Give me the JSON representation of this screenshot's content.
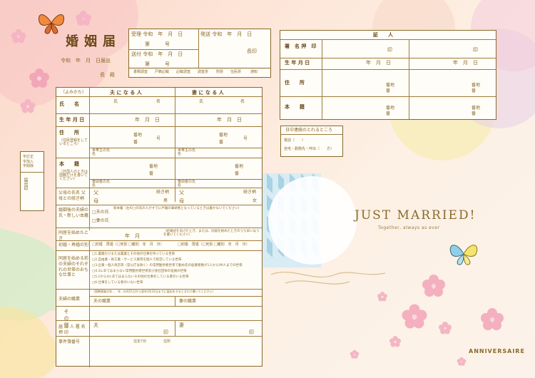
{
  "header": {
    "title": "婚姻届",
    "filed_date": "令和　年　月　日届出",
    "to_mayor": "長　殿"
  },
  "receipt": {
    "received": "受理 令和　年　月　日",
    "number1": "第　　　号",
    "sent": "送付 令和　年　月　日",
    "number2": "第　　　号",
    "issue": "発送 令和　年　月　日",
    "head": "長印",
    "checks": [
      "書類調査",
      "戸籍記載",
      "記載調査",
      "調査票",
      "附票",
      "住民票",
      "通知"
    ]
  },
  "side_stamp": {
    "label1": "字訂正\n字加入\n字削除",
    "label2": "届出印"
  },
  "columns": {
    "furigana": "（よみかた）",
    "husband": "夫 に な る 人",
    "wife": "妻 に な る 人"
  },
  "rows": {
    "name": "氏　　名",
    "name_sub_last": "氏",
    "name_sub_first": "名",
    "birth": "生 年 月 日",
    "birth_val": "年　月　日",
    "address": "住　　所",
    "address_note": "（住民登録をしているところ）",
    "banchi": "番地",
    "ban": "番",
    "go": "号",
    "setainushi": "世帯主の氏名",
    "honseki": "本　　籍",
    "honseki_note": "（外国人のときは国籍だけを書いてください）",
    "hittousha": "筆頭者の氏名",
    "parents": "父母の氏名 父母との続き柄",
    "father": "父",
    "mother": "母",
    "relation": "続き柄",
    "son": "男",
    "daughter": "女",
    "after_name": "婚姻後の夫婦の氏・新しい本籍",
    "husband_name_opt": "□夫の氏",
    "wife_name_opt": "□妻の氏",
    "new_honseki": "新本籍（左の□の氏の人がすでに戸籍の筆頭者となっているときは書かないでください）",
    "cohabit": "同居を始めたとき",
    "cohabit_val": "年　月",
    "cohabit_note": "（結婚式をあげたとき、または、同居を始めたときのうち早いほうを書いてください）",
    "prev": "初婚・再婚の別",
    "first": "□初婚　再婚（□死別 □離別　年　月　日）",
    "occupation_before": "同居を始める前の夫婦のそれぞれの世帯のおもな仕事と",
    "jobs": [
      "□1.農業だけまたは農業とその他の仕事を持っている世帯",
      "□2.自由業・商工業・サービス業等を個人で経営している世帯",
      "□3.企業・個人商店等（官公庁は除く）の常用勤労者世帯で勤め先の従業者数が1人から99人までの世帯",
      "□4.3にあてはまらない常用勤労者世帯及び会社団体の役員の世帯",
      "□5.1から4にあてはまらないその他の仕事をしている者のいる世帯",
      "□6.仕事をしている者のいない世帯"
    ],
    "job": "夫婦の職業",
    "job_note": "（国勢調査の年…　年…の4月1日から翌年3月31日までに届出をするときだけ書いてください）",
    "husband_job": "夫の職業",
    "wife_job": "妻の職業",
    "other": "そ の 他",
    "signer": "届 出 人 署 名 押 印",
    "signer_h": "夫",
    "signer_w": "妻",
    "seal": "印",
    "contact": "事件簿番号",
    "contact_a": "住定7日",
    "contact_b": "住所"
  },
  "witness": {
    "title": "証　　人",
    "sign": "署　名 押　印",
    "seal": "印",
    "birth": "生 年 月 日",
    "birth_val": "年　月　日",
    "address": "住　　所",
    "honseki": "本　　籍",
    "banchi": "番地",
    "ban": "番"
  },
  "daytime": {
    "title": "日中連絡のとれるところ",
    "phone": "電話（　　）",
    "home": "自宅・勤務先・呼出（　　方）"
  },
  "brand": {
    "headline": "JUST MARRIED!",
    "tagline": "Together, always as ever",
    "logo": "ANNIVERSAIRE"
  },
  "colors": {
    "gold": "#8a6a2a",
    "pink": "#f4b6c4",
    "mint": "#d6ecd8",
    "blue": "#bcdcec"
  }
}
